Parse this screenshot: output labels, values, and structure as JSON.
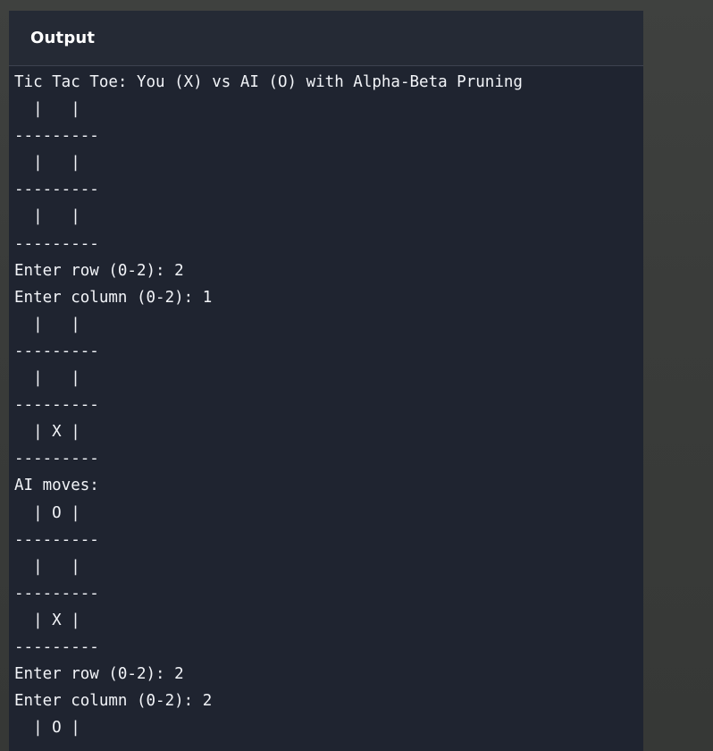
{
  "output_panel": {
    "title": "Output",
    "lines": [
      "Tic Tac Toe: You (X) vs AI (O) with Alpha-Beta Pruning",
      "  |   |  ",
      "---------",
      "  |   |  ",
      "---------",
      "  |   |  ",
      "---------",
      "Enter row (0-2): 2",
      "Enter column (0-2): 1",
      "  |   |  ",
      "---------",
      "  |   |  ",
      "---------",
      "  | X |  ",
      "---------",
      "AI moves:",
      "  | O |  ",
      "---------",
      "  |   |  ",
      "---------",
      "  | X |  ",
      "---------",
      "Enter row (0-2): 2",
      "Enter column (0-2): 2",
      "  | O |  "
    ]
  }
}
